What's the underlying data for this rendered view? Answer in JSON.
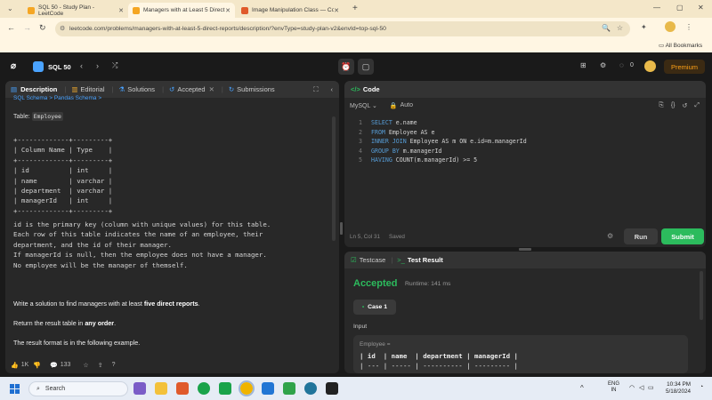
{
  "browser": {
    "tabs": [
      {
        "label": "SQL 50 - Study Plan - LeetCode",
        "active": false,
        "fav_color": "#f5a623"
      },
      {
        "label": "Managers with at Least 5 Direct",
        "active": true,
        "fav_color": "#f5a623"
      },
      {
        "label": "Image Manipulation Class — Co",
        "active": false,
        "fav_color": "#e05a2b"
      }
    ],
    "new_tab": "+",
    "window_controls": [
      "—",
      "▢",
      "✕"
    ],
    "url": "leetcode.com/problems/managers-with-at-least-5-direct-reports/description/?envType=study-plan-v2&envId=top-sql-50",
    "bookmarks_label": "All Bookmarks"
  },
  "lcnav": {
    "study_plan": "SQL 50",
    "fire_count": "0",
    "premium": "Premium"
  },
  "left": {
    "tabs": [
      "Description",
      "Editorial",
      "Solutions",
      "Accepted",
      "Submissions"
    ],
    "schema_links": "SQL Schema  >      Pandas Schema  >",
    "table_label": "Table:",
    "table_name": "Employee",
    "schema_pre": "+-------------+---------+\n| Column Name | Type    |\n+-------------+---------+\n| id          | int     |\n| name        | varchar |\n| department  | varchar |\n| managerId   | int     |\n+-------------+---------+",
    "desc_pre": "id is the primary key (column with unique values) for this table.\nEach row of this table indicates the name of an employee, their\ndepartment, and the id of their manager.\nIf managerId is null, then the employee does not have a manager.\nNo employee will be the manager of themself.",
    "p1_pre": "Write a solution to find managers with at least ",
    "p1_bold": "five direct reports",
    "p1_post": ".",
    "p2_pre": "Return the result table in ",
    "p2_bold": "any order",
    "p2_post": ".",
    "p3": "The result format is in the following example.",
    "likes": "1K",
    "comments": "133"
  },
  "code": {
    "title": "Code",
    "language": "MySQL",
    "auto": "Auto",
    "lines": [
      {
        "n": "1",
        "kw": "SELECT",
        "rest": " e.name"
      },
      {
        "n": "2",
        "kw": "FROM",
        "rest": " Employee AS e"
      },
      {
        "n": "3",
        "kw": "INNER JOIN",
        "rest": " Employee AS m ON e.id=m.managerId"
      },
      {
        "n": "4",
        "kw": "GROUP BY",
        "rest": " m.managerId"
      },
      {
        "n": "5",
        "kw": "HAVING",
        "rest": " COUNT(m.managerId) >= 5"
      }
    ],
    "status": "Ln 5, Col 31",
    "saved": "Saved",
    "run": "Run",
    "submit": "Submit"
  },
  "test": {
    "tab1": "Testcase",
    "tab2": "Test Result",
    "result": "Accepted",
    "runtime": "Runtime: 141 ms",
    "case": "Case 1",
    "input_label": "Input",
    "employee_label": "Employee =",
    "header_row": "| id  | name  | department | managerId |",
    "sep_row": "| --- | ----- | ---------- | --------- |"
  },
  "taskbar": {
    "search": "Search",
    "lang1": "ENG",
    "lang2": "IN",
    "time": "10:34 PM",
    "date": "5/18/2024"
  },
  "colors": {
    "accent": "#ffa116",
    "green": "#2cbb5d",
    "submit": "#2cbb5d"
  }
}
